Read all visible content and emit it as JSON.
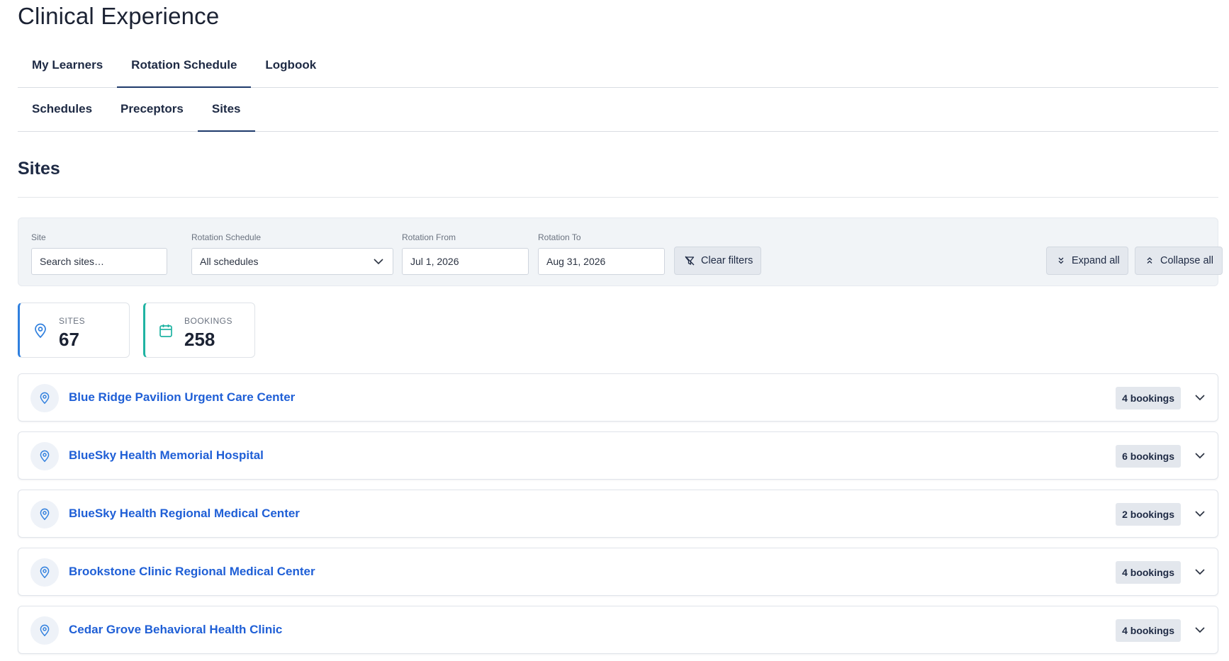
{
  "app": {
    "title": "Clinical Experience"
  },
  "primary_tabs": [
    {
      "label": "My Learners",
      "active": false
    },
    {
      "label": "Rotation Schedule",
      "active": true
    },
    {
      "label": "Logbook",
      "active": false
    }
  ],
  "secondary_tabs": [
    {
      "label": "Schedules",
      "active": false
    },
    {
      "label": "Preceptors",
      "active": false
    },
    {
      "label": "Sites",
      "active": true
    }
  ],
  "section": {
    "title": "Sites"
  },
  "filters": {
    "site": {
      "label": "Site",
      "placeholder": "Search sites…",
      "value": ""
    },
    "schedule": {
      "label": "Rotation Schedule",
      "value": "All schedules"
    },
    "from": {
      "label": "Rotation From",
      "value": "Jul 1, 2026"
    },
    "to": {
      "label": "Rotation To",
      "value": "Aug 31, 2026"
    },
    "clear_label": "Clear filters",
    "expand_label": "Expand all",
    "collapse_label": "Collapse all"
  },
  "stats": {
    "sites": {
      "label": "SITES",
      "value": "67",
      "accent": "#2f7fde",
      "icon": "map-pin-icon"
    },
    "bookings": {
      "label": "BOOKINGS",
      "value": "258",
      "accent": "#1fb3a2",
      "icon": "calendar-icon"
    }
  },
  "sites": [
    {
      "name": "Blue Ridge Pavilion Urgent Care Center",
      "bookings": "4 bookings"
    },
    {
      "name": "BlueSky Health Memorial Hospital",
      "bookings": "6 bookings"
    },
    {
      "name": "BlueSky Health Regional Medical Center",
      "bookings": "2 bookings"
    },
    {
      "name": "Brookstone Clinic Regional Medical Center",
      "bookings": "4 bookings"
    },
    {
      "name": "Cedar Grove Behavioral Health Clinic",
      "bookings": "4 bookings"
    }
  ],
  "colors": {
    "link": "#1f5fd6",
    "text": "#1e2a44",
    "panel": "#f1f4f7"
  }
}
